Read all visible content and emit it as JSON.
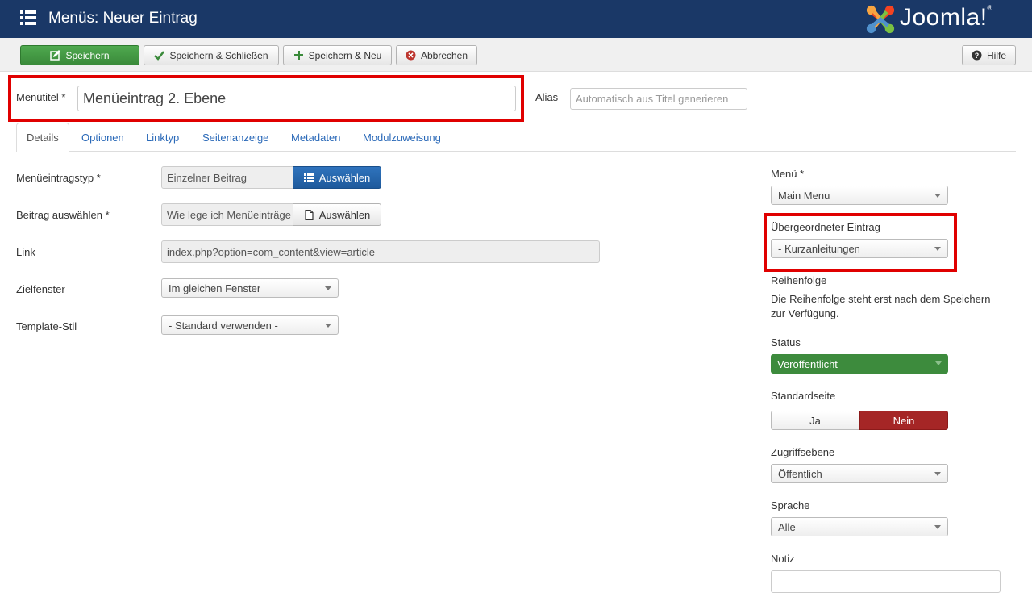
{
  "header": {
    "title": "Menüs: Neuer Eintrag",
    "logo_text": "Joomla!",
    "logo_reg": "®"
  },
  "toolbar": {
    "save": "Speichern",
    "save_close": "Speichern & Schließen",
    "save_new": "Speichern & Neu",
    "cancel": "Abbrechen",
    "help": "Hilfe"
  },
  "title_row": {
    "title_label": "Menütitel *",
    "title_value": "Menüeintrag 2. Ebene",
    "alias_label": "Alias",
    "alias_placeholder": "Automatisch aus Titel generieren"
  },
  "tabs": [
    {
      "label": "Details"
    },
    {
      "label": "Optionen"
    },
    {
      "label": "Linktyp"
    },
    {
      "label": "Seitenanzeige"
    },
    {
      "label": "Metadaten"
    },
    {
      "label": "Modulzuweisung"
    }
  ],
  "left_form": {
    "type_label": "Menüeintragstyp *",
    "type_value": "Einzelner Beitrag",
    "type_button": "Auswählen",
    "article_label": "Beitrag auswählen *",
    "article_value": "Wie lege ich Menüeinträge",
    "article_button": "Auswählen",
    "link_label": "Link",
    "link_value": "index.php?option=com_content&view=article",
    "target_label": "Zielfenster",
    "target_value": "Im gleichen Fenster",
    "template_label": "Template-Stil",
    "template_value": "- Standard verwenden -"
  },
  "right_form": {
    "menu_label": "Menü *",
    "menu_value": "Main Menu",
    "parent_label": "Übergeordneter Eintrag",
    "parent_value": "- Kurzanleitungen",
    "order_label": "Reihenfolge",
    "order_help": "Die Reihenfolge steht erst nach dem Speichern zur Verfügung.",
    "status_label": "Status",
    "status_value": "Veröffentlicht",
    "default_label": "Standardseite",
    "default_yes": "Ja",
    "default_no": "Nein",
    "access_label": "Zugriffsebene",
    "access_value": "Öffentlich",
    "language_label": "Sprache",
    "language_value": "Alle",
    "note_label": "Notiz"
  },
  "colors": {
    "header_bg": "#1a3867",
    "save_green": "#3d8b3d",
    "highlight_red": "#e00000",
    "nein_red": "#a52626",
    "link_blue": "#2a69b8"
  }
}
